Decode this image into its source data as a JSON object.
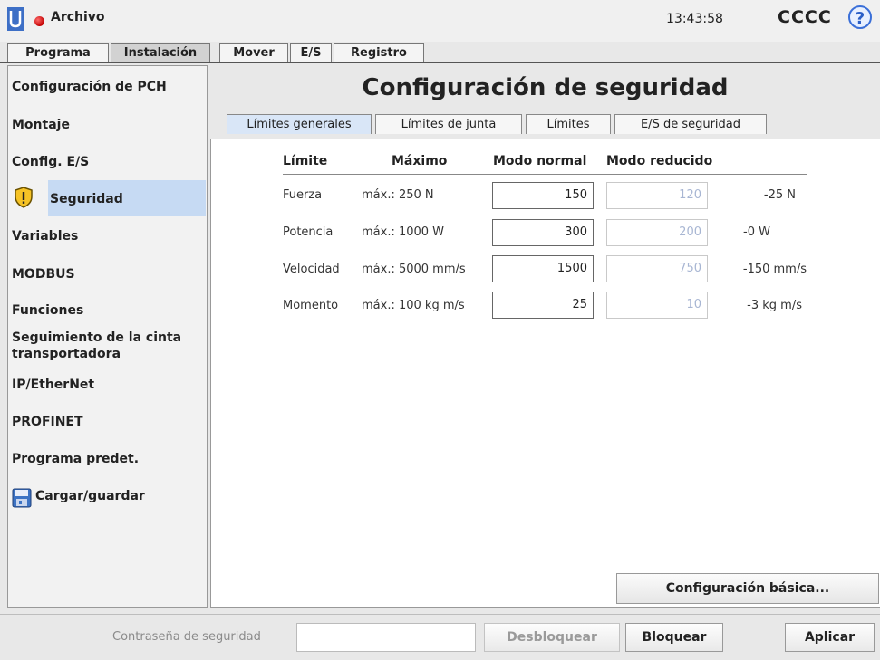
{
  "topbar": {
    "file_menu": "Archivo",
    "clock": "13:43:58",
    "robot_name": "CCCC",
    "help_symbol": "?"
  },
  "main_tabs": [
    "Programa",
    "Instalación",
    "Mover",
    "E/S",
    "Registro"
  ],
  "sidebar": {
    "items": [
      {
        "label": "Configuración de PCH"
      },
      {
        "label": "Montaje"
      },
      {
        "label": "Config. E/S"
      },
      {
        "label": "Seguridad",
        "icon": "shield-warning-icon",
        "selected": true
      },
      {
        "label": "Variables"
      },
      {
        "label": "MODBUS"
      },
      {
        "label": "Funciones"
      },
      {
        "label": "Seguimiento de la cinta transportadora"
      },
      {
        "label": "IP/EtherNet"
      },
      {
        "label": "PROFINET"
      },
      {
        "label": "Programa predet."
      },
      {
        "label": "Cargar/guardar",
        "icon": "save-disk-icon"
      }
    ]
  },
  "page": {
    "title": "Configuración de seguridad"
  },
  "sub_tabs": [
    "Límites generales",
    "Límites de junta",
    "Límites",
    "E/S de seguridad"
  ],
  "table": {
    "headers": {
      "limit": "Límite",
      "max": "Máximo",
      "normal": "Modo normal",
      "reduced": "Modo reducido"
    },
    "rows": [
      {
        "name": "Fuerza",
        "max": "máx.: 250 N",
        "normal": "150",
        "reduced": "120",
        "delta": "-25 N"
      },
      {
        "name": "Potencia",
        "max": "máx.: 1000 W",
        "normal": "300",
        "reduced": "200",
        "delta": "-0 W"
      },
      {
        "name": "Velocidad",
        "max": "máx.: 5000 mm/s",
        "normal": "1500",
        "reduced": "750",
        "delta": "-150 mm/s"
      },
      {
        "name": "Momento",
        "max": "máx.: 100 kg m/s",
        "normal": "25",
        "reduced": "10",
        "delta": "-3 kg m/s"
      }
    ]
  },
  "buttons": {
    "basic_config": "Configuración básica...",
    "unlock": "Desbloquear",
    "lock": "Bloquear",
    "apply": "Aplicar"
  },
  "password": {
    "label": "Contraseña de seguridad",
    "value": ""
  },
  "colors": {
    "selection": "#c6daf3",
    "accent": "#3a6fd8",
    "status_red": "#c10000"
  }
}
